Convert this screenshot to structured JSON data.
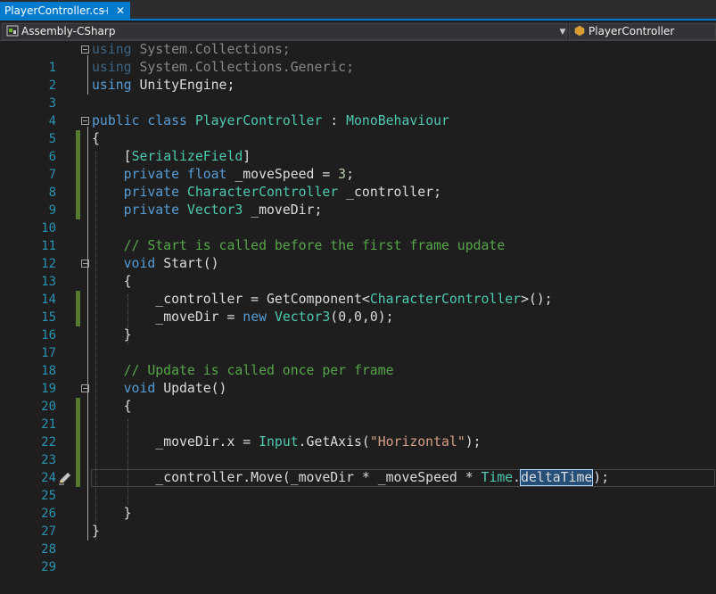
{
  "tab": {
    "title": "PlayerController.cs",
    "pin": "⊣",
    "close": "✕"
  },
  "nav": {
    "project": "Assembly-CSharp",
    "class": "PlayerController"
  },
  "lines": [
    {
      "n": "1"
    },
    {
      "n": "2"
    },
    {
      "n": "3"
    },
    {
      "n": "4"
    },
    {
      "n": "5"
    },
    {
      "n": "6"
    },
    {
      "n": "7"
    },
    {
      "n": "8"
    },
    {
      "n": "9"
    },
    {
      "n": "10"
    },
    {
      "n": "11"
    },
    {
      "n": "12"
    },
    {
      "n": "13"
    },
    {
      "n": "14"
    },
    {
      "n": "15"
    },
    {
      "n": "16"
    },
    {
      "n": "17"
    },
    {
      "n": "18"
    },
    {
      "n": "19"
    },
    {
      "n": "20"
    },
    {
      "n": "21"
    },
    {
      "n": "22"
    },
    {
      "n": "23"
    },
    {
      "n": "24"
    },
    {
      "n": "25"
    },
    {
      "n": "26"
    },
    {
      "n": "27"
    },
    {
      "n": "28"
    },
    {
      "n": "29"
    }
  ],
  "code": {
    "l1": {
      "kw": "using",
      "rest": " System.Collections;"
    },
    "l2": {
      "kw": "using",
      "rest": " System.Collections.Generic;"
    },
    "l3": {
      "kw": "using",
      "rest": " UnityEngine;"
    },
    "l5": {
      "kw": "public class",
      "sp": " ",
      "type": "PlayerController",
      "mid": " : ",
      "base": "MonoBehaviour"
    },
    "l6": "{",
    "l7": {
      "open": "[",
      "attr": "SerializeField",
      "close": "]"
    },
    "l8": {
      "kw": "private float",
      "rest": " _moveSpeed = ",
      "num": "3",
      "end": ";"
    },
    "l9": {
      "kw": "private",
      "sp": " ",
      "type": "CharacterController",
      "rest": " _controller;"
    },
    "l10": {
      "kw": "private",
      "sp": " ",
      "type": "Vector3",
      "rest": " _moveDir;"
    },
    "l12": "// Start is called before the first frame update",
    "l13": {
      "kw": "void",
      "rest": " Start()"
    },
    "l14": "{",
    "l15": {
      "a": "_controller = GetComponent<",
      "type": "CharacterController",
      "b": ">();"
    },
    "l16": {
      "a": "_moveDir = ",
      "kw": "new",
      "sp": " ",
      "type": "Vector3",
      "b": "(0,0,0);"
    },
    "l17": "}",
    "l19": "// Update is called once per frame",
    "l20": {
      "kw": "void",
      "rest": " Update()"
    },
    "l21": "{",
    "l23": {
      "a": "_moveDir.x = ",
      "type": "Input",
      "b": ".GetAxis(",
      "str": "\"Horizontal\"",
      "c": ");"
    },
    "l25": {
      "a": "_controller.Move(_moveDir * _moveSpeed * ",
      "type": "Time",
      "b": ".",
      "sel": "deltaTime",
      "c": ");"
    },
    "l27": "}",
    "l28": "}"
  },
  "colors": {
    "accent": "#007acc",
    "keyword": "#569cd6",
    "type": "#4ec9b0",
    "comment": "#57a64a",
    "string": "#d69d85",
    "number": "#b5cea8",
    "linenum": "#2b91af",
    "changed": "#577b2e"
  }
}
